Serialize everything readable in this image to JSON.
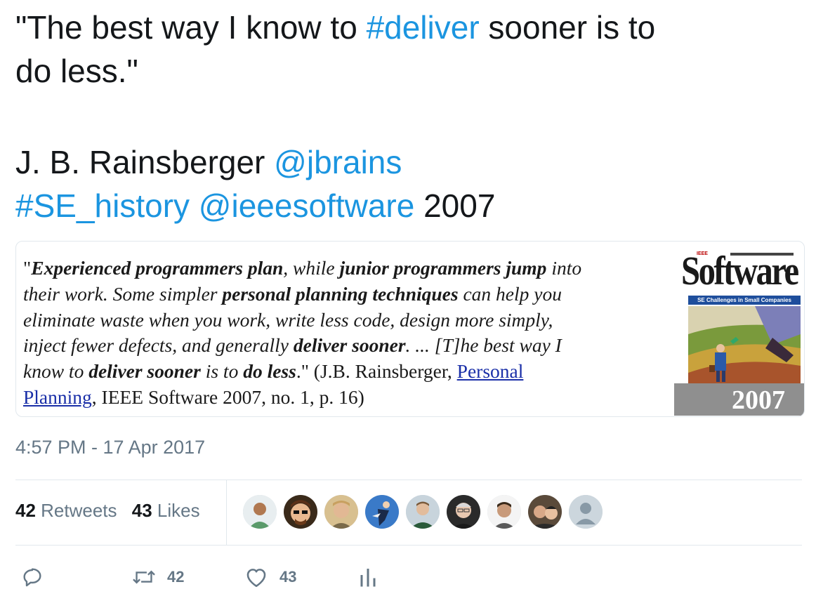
{
  "tweet": {
    "line1_a": "\"The best way I know to ",
    "line1_hashtag": "#deliver",
    "line1_b": " sooner is to",
    "line2": "do less.\"",
    "author_name": "J. B. Rainsberger ",
    "author_handle": "@jbrains",
    "hashtag_history": "#SE_history",
    "space": " ",
    "mention_ieee": "@ieeesoftware",
    "year": " 2007"
  },
  "card": {
    "q1_a": "\"",
    "q1_b": "Experienced programmers plan",
    "q1_c": ", while ",
    "q1_d": "junior programmers jump",
    "q1_e": " into",
    "q2_a": "their work. Some simpler ",
    "q2_b": "personal planning techniques",
    "q2_c": " can help you",
    "q3": "eliminate waste when you work, write less code, design more simply,",
    "q4_a": "inject fewer defects, and generally ",
    "q4_b": "deliver sooner",
    "q4_c": ". ... [T]he best way I",
    "q5_a": "know to ",
    "q5_b": "deliver sooner",
    "q5_c": " is to ",
    "q5_d": "do less",
    "q5_e": ".\" (J.B. Rainsberger, ",
    "q5_link": "Personal",
    "q6_link": "Planning",
    "q6_rest": ", IEEE Software 2007, no. 1, p. 16)",
    "cover_ieee": "IEEE",
    "cover_title": "Software",
    "cover_subtitle": "SE Challenges in Small Companies",
    "cover_year": "2007"
  },
  "meta": {
    "timestamp": "4:57 PM - 17 Apr 2017"
  },
  "stats": {
    "retweets_count": "42",
    "retweets_label": " Retweets",
    "likes_count": "43",
    "likes_label": " Likes"
  },
  "actions": {
    "reply_icon": "reply-icon",
    "retweet_icon": "retweet-icon",
    "retweet_count": "42",
    "like_icon": "heart-icon",
    "like_count": "43",
    "analytics_icon": "analytics-icon"
  },
  "colors": {
    "link": "#1b95e0",
    "text": "#14171a",
    "muted": "#657786",
    "border": "#e1e8ed"
  }
}
